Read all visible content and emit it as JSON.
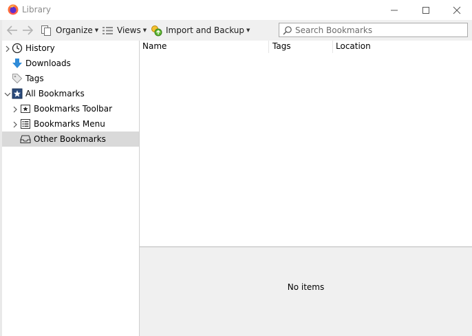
{
  "window": {
    "title": "Library"
  },
  "toolbar": {
    "organize_label": "Organize",
    "views_label": "Views",
    "import_label": "Import and Backup",
    "search_placeholder": "Search Bookmarks",
    "search_value": ""
  },
  "sidebar": {
    "items": [
      {
        "label": "History",
        "icon": "clock-icon",
        "expandable": true,
        "expanded": false,
        "level": 0
      },
      {
        "label": "Downloads",
        "icon": "download-arrow-icon",
        "expandable": false,
        "level": 0
      },
      {
        "label": "Tags",
        "icon": "tag-icon",
        "expandable": false,
        "level": 0
      },
      {
        "label": "All Bookmarks",
        "icon": "star-bookmarks-icon",
        "expandable": true,
        "expanded": true,
        "level": 0
      },
      {
        "label": "Bookmarks Toolbar",
        "icon": "bookmark-toolbar-icon",
        "expandable": true,
        "expanded": false,
        "level": 1
      },
      {
        "label": "Bookmarks Menu",
        "icon": "bookmark-menu-icon",
        "expandable": true,
        "expanded": false,
        "level": 1
      },
      {
        "label": "Other Bookmarks",
        "icon": "tray-icon",
        "expandable": false,
        "level": 1,
        "selected": true
      }
    ]
  },
  "content": {
    "columns": [
      "Name",
      "Tags",
      "Location"
    ],
    "rows": [],
    "details_text": "No items"
  }
}
